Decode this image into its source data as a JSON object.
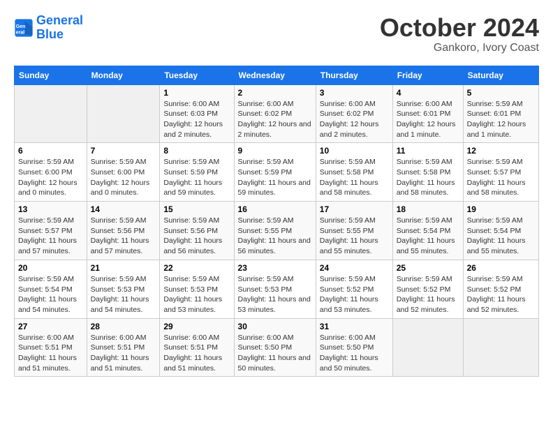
{
  "header": {
    "logo_line1": "General",
    "logo_line2": "Blue",
    "month": "October 2024",
    "location": "Gankoro, Ivory Coast"
  },
  "weekdays": [
    "Sunday",
    "Monday",
    "Tuesday",
    "Wednesday",
    "Thursday",
    "Friday",
    "Saturday"
  ],
  "weeks": [
    [
      null,
      null,
      {
        "day": 1,
        "sunrise": "6:00 AM",
        "sunset": "6:03 PM",
        "daylight": "12 hours and 2 minutes."
      },
      {
        "day": 2,
        "sunrise": "6:00 AM",
        "sunset": "6:02 PM",
        "daylight": "12 hours and 2 minutes."
      },
      {
        "day": 3,
        "sunrise": "6:00 AM",
        "sunset": "6:02 PM",
        "daylight": "12 hours and 2 minutes."
      },
      {
        "day": 4,
        "sunrise": "6:00 AM",
        "sunset": "6:01 PM",
        "daylight": "12 hours and 1 minute."
      },
      {
        "day": 5,
        "sunrise": "5:59 AM",
        "sunset": "6:01 PM",
        "daylight": "12 hours and 1 minute."
      }
    ],
    [
      {
        "day": 6,
        "sunrise": "5:59 AM",
        "sunset": "6:00 PM",
        "daylight": "12 hours and 0 minutes."
      },
      {
        "day": 7,
        "sunrise": "5:59 AM",
        "sunset": "6:00 PM",
        "daylight": "12 hours and 0 minutes."
      },
      {
        "day": 8,
        "sunrise": "5:59 AM",
        "sunset": "5:59 PM",
        "daylight": "11 hours and 59 minutes."
      },
      {
        "day": 9,
        "sunrise": "5:59 AM",
        "sunset": "5:59 PM",
        "daylight": "11 hours and 59 minutes."
      },
      {
        "day": 10,
        "sunrise": "5:59 AM",
        "sunset": "5:58 PM",
        "daylight": "11 hours and 58 minutes."
      },
      {
        "day": 11,
        "sunrise": "5:59 AM",
        "sunset": "5:58 PM",
        "daylight": "11 hours and 58 minutes."
      },
      {
        "day": 12,
        "sunrise": "5:59 AM",
        "sunset": "5:57 PM",
        "daylight": "11 hours and 58 minutes."
      }
    ],
    [
      {
        "day": 13,
        "sunrise": "5:59 AM",
        "sunset": "5:57 PM",
        "daylight": "11 hours and 57 minutes."
      },
      {
        "day": 14,
        "sunrise": "5:59 AM",
        "sunset": "5:56 PM",
        "daylight": "11 hours and 57 minutes."
      },
      {
        "day": 15,
        "sunrise": "5:59 AM",
        "sunset": "5:56 PM",
        "daylight": "11 hours and 56 minutes."
      },
      {
        "day": 16,
        "sunrise": "5:59 AM",
        "sunset": "5:55 PM",
        "daylight": "11 hours and 56 minutes."
      },
      {
        "day": 17,
        "sunrise": "5:59 AM",
        "sunset": "5:55 PM",
        "daylight": "11 hours and 55 minutes."
      },
      {
        "day": 18,
        "sunrise": "5:59 AM",
        "sunset": "5:54 PM",
        "daylight": "11 hours and 55 minutes."
      },
      {
        "day": 19,
        "sunrise": "5:59 AM",
        "sunset": "5:54 PM",
        "daylight": "11 hours and 55 minutes."
      }
    ],
    [
      {
        "day": 20,
        "sunrise": "5:59 AM",
        "sunset": "5:54 PM",
        "daylight": "11 hours and 54 minutes."
      },
      {
        "day": 21,
        "sunrise": "5:59 AM",
        "sunset": "5:53 PM",
        "daylight": "11 hours and 54 minutes."
      },
      {
        "day": 22,
        "sunrise": "5:59 AM",
        "sunset": "5:53 PM",
        "daylight": "11 hours and 53 minutes."
      },
      {
        "day": 23,
        "sunrise": "5:59 AM",
        "sunset": "5:53 PM",
        "daylight": "11 hours and 53 minutes."
      },
      {
        "day": 24,
        "sunrise": "5:59 AM",
        "sunset": "5:52 PM",
        "daylight": "11 hours and 53 minutes."
      },
      {
        "day": 25,
        "sunrise": "5:59 AM",
        "sunset": "5:52 PM",
        "daylight": "11 hours and 52 minutes."
      },
      {
        "day": 26,
        "sunrise": "5:59 AM",
        "sunset": "5:52 PM",
        "daylight": "11 hours and 52 minutes."
      }
    ],
    [
      {
        "day": 27,
        "sunrise": "6:00 AM",
        "sunset": "5:51 PM",
        "daylight": "11 hours and 51 minutes."
      },
      {
        "day": 28,
        "sunrise": "6:00 AM",
        "sunset": "5:51 PM",
        "daylight": "11 hours and 51 minutes."
      },
      {
        "day": 29,
        "sunrise": "6:00 AM",
        "sunset": "5:51 PM",
        "daylight": "11 hours and 51 minutes."
      },
      {
        "day": 30,
        "sunrise": "6:00 AM",
        "sunset": "5:50 PM",
        "daylight": "11 hours and 50 minutes."
      },
      {
        "day": 31,
        "sunrise": "6:00 AM",
        "sunset": "5:50 PM",
        "daylight": "11 hours and 50 minutes."
      },
      null,
      null
    ]
  ]
}
